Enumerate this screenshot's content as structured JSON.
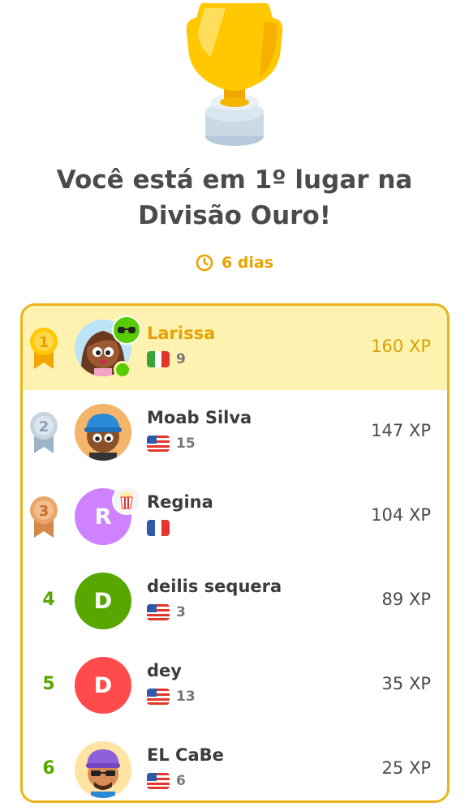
{
  "headline": "Você está em 1º lugar na Divisão Ouro!",
  "timer": {
    "icon": "clock-icon",
    "text": "6 dias"
  },
  "colors": {
    "gold": "#f7c325",
    "accent": "#e8a200",
    "highlight": "#fdf2b0",
    "rank_green": "#58a700"
  },
  "leaderboard": [
    {
      "rank": "1",
      "name": "Larissa",
      "flag": "italy-flag-icon",
      "streak": "9",
      "xp": "160 XP"
    },
    {
      "rank": "2",
      "name": "Moab Silva",
      "flag": "us-flag-icon",
      "streak": "15",
      "xp": "147 XP"
    },
    {
      "rank": "3",
      "name": "Regina",
      "flag": "france-flag-icon",
      "streak": "",
      "xp": "104 XP",
      "avatar_initial": "R"
    },
    {
      "rank": "4",
      "name": "deilis sequera",
      "flag": "us-flag-icon",
      "streak": "3",
      "xp": "89 XP",
      "avatar_initial": "D"
    },
    {
      "rank": "5",
      "name": "dey",
      "flag": "us-flag-icon",
      "streak": "13",
      "xp": "35 XP",
      "avatar_initial": "D"
    },
    {
      "rank": "6",
      "name": "EL CaBe",
      "flag": "us-flag-icon",
      "streak": "6",
      "xp": "25 XP"
    }
  ]
}
